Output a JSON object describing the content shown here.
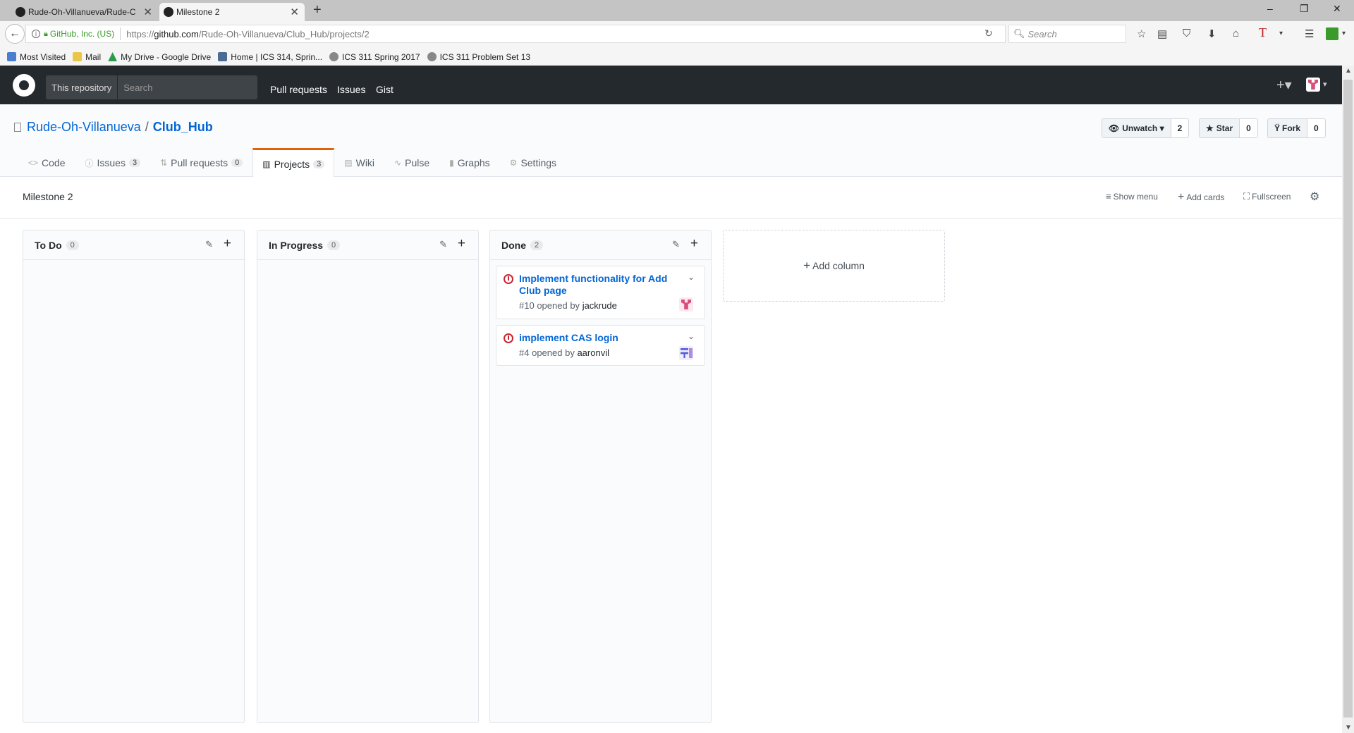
{
  "browser": {
    "tabs": [
      {
        "title": "Rude-Oh-Villanueva/Rude-C",
        "active": false
      },
      {
        "title": "Milestone 2",
        "active": true
      }
    ],
    "new_tab": "+",
    "window_controls": {
      "minimize": "–",
      "restore": "❐",
      "close": "✕"
    },
    "site_identity": "GitHub, Inc. (US)",
    "url_prefix": "https://",
    "url_domain": "github.com",
    "url_path": "/Rude-Oh-Villanueva/Club_Hub/projects/2",
    "search_placeholder": "Search",
    "bookmarks": [
      {
        "label": "Most Visited",
        "color": "#4a7fd0"
      },
      {
        "label": "Mail",
        "color": "#e8c64a"
      },
      {
        "label": "My Drive - Google Drive",
        "color": "#2d9c4a"
      },
      {
        "label": "Home | ICS 314, Sprin...",
        "color": "#4c6a96"
      },
      {
        "label": "ICS 311 Spring 2017",
        "color": "#888888"
      },
      {
        "label": "ICS 311 Problem Set 13",
        "color": "#888888"
      }
    ]
  },
  "github_header": {
    "scope_label": "This repository",
    "search_placeholder": "Search",
    "nav": [
      "Pull requests",
      "Issues",
      "Gist"
    ],
    "plus": "+▾",
    "avatar_caret": "▾"
  },
  "repo": {
    "owner": "Rude-Oh-Villanueva",
    "separator": "/",
    "name": "Club_Hub",
    "buttons": [
      {
        "label": "Unwatch ▾",
        "icon": "eye-icon",
        "count": "2"
      },
      {
        "label": "Star",
        "icon": "star-icon",
        "count": "0"
      },
      {
        "label": "Fork",
        "icon": "fork-icon",
        "count": "0"
      }
    ],
    "tabs": [
      {
        "label": "Code",
        "icon": "<>",
        "count": null,
        "selected": false
      },
      {
        "label": "Issues",
        "icon": "ⓘ",
        "count": "3",
        "selected": false
      },
      {
        "label": "Pull requests",
        "icon": "⇅",
        "count": "0",
        "selected": false
      },
      {
        "label": "Projects",
        "icon": "▥",
        "count": "3",
        "selected": true
      },
      {
        "label": "Wiki",
        "icon": "▤",
        "count": null,
        "selected": false
      },
      {
        "label": "Pulse",
        "icon": "∿",
        "count": null,
        "selected": false
      },
      {
        "label": "Graphs",
        "icon": "▮",
        "count": null,
        "selected": false
      },
      {
        "label": "Settings",
        "icon": "⚙",
        "count": null,
        "selected": false
      }
    ]
  },
  "project": {
    "name": "Milestone 2",
    "tools": [
      {
        "label": "Show menu",
        "icon": "≡"
      },
      {
        "label": "Add cards",
        "icon": "+"
      },
      {
        "label": "Fullscreen",
        "icon": "⛶"
      }
    ],
    "settings_icon": "⚙",
    "add_column_label": "Add column",
    "columns": [
      {
        "name": "To Do",
        "count": "0",
        "cards": []
      },
      {
        "name": "In Progress",
        "count": "0",
        "cards": []
      },
      {
        "name": "Done",
        "count": "2",
        "cards": [
          {
            "title": "Implement functionality for Add Club page",
            "number": "#10",
            "opened_by_text": "opened by",
            "author": "jackrude",
            "status": "closed",
            "avatar_color": "#d94f7c"
          },
          {
            "title": "implement CAS login",
            "number": "#4",
            "opened_by_text": "opened by",
            "author": "aaronvil",
            "status": "closed",
            "avatar_color": "#5a5fd6"
          }
        ]
      }
    ]
  },
  "colors": {
    "accent_orange": "#e36209",
    "link_blue": "#0366d6",
    "closed_red": "#cb2431",
    "header_dark": "#24292e"
  }
}
